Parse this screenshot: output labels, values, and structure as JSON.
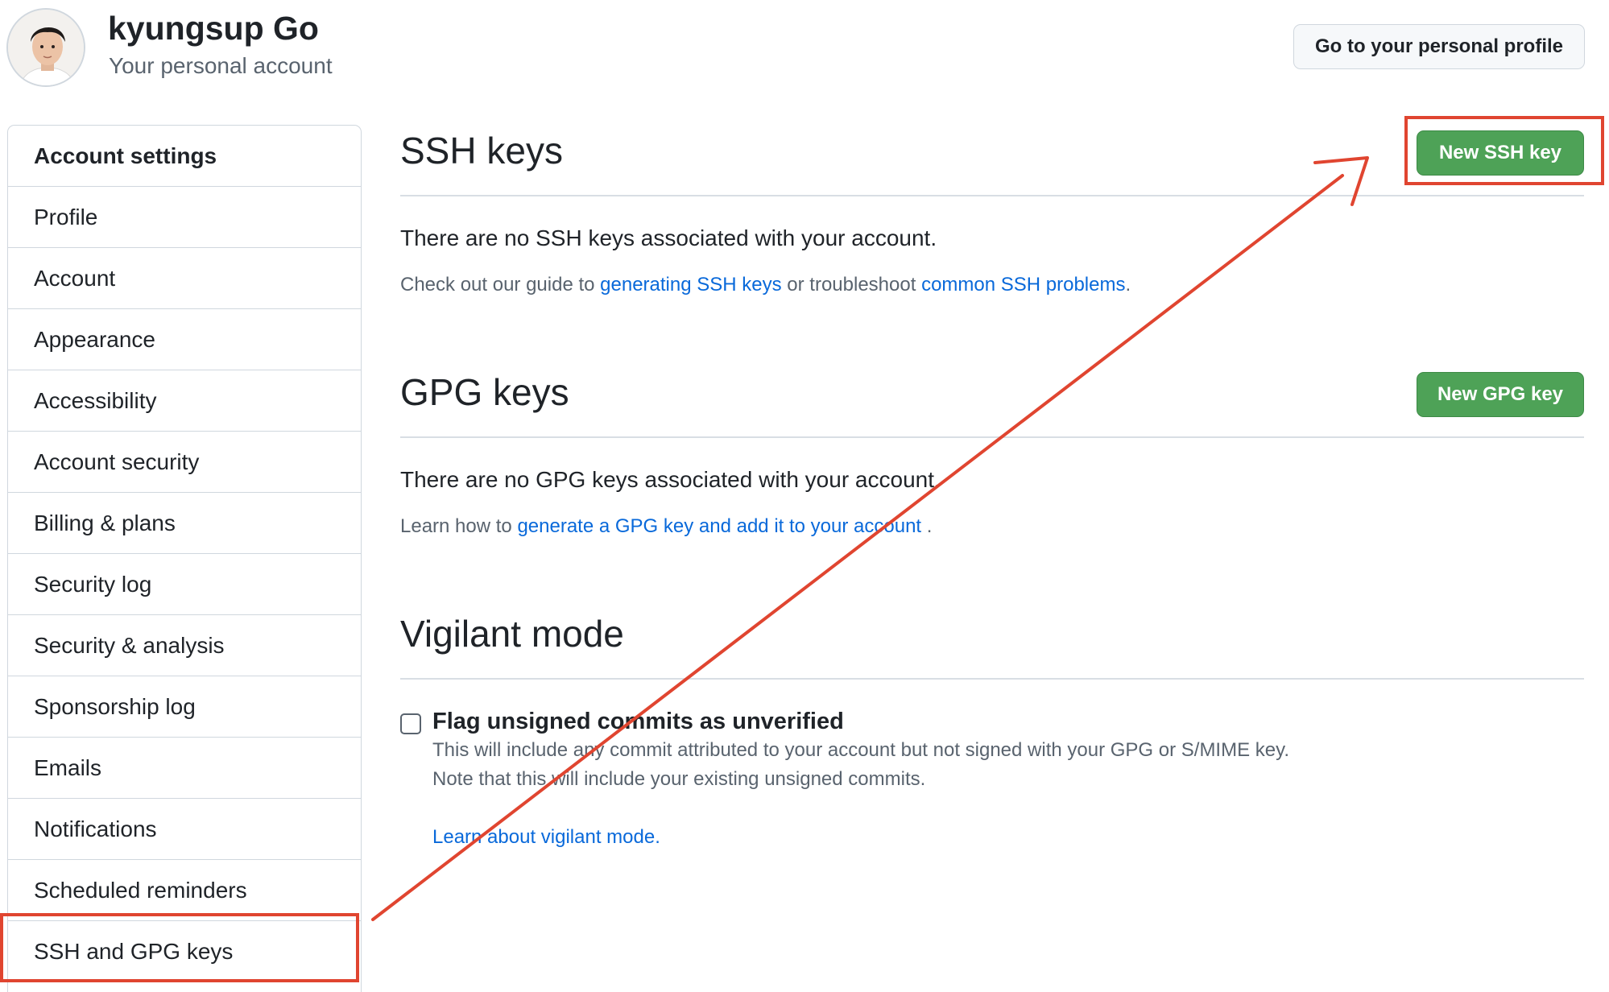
{
  "header": {
    "user_name": "kyungsup Go",
    "subtitle": "Your personal account",
    "profile_button": "Go to your personal profile"
  },
  "sidebar": {
    "heading": "Account settings",
    "items": [
      {
        "label": "Profile"
      },
      {
        "label": "Account"
      },
      {
        "label": "Appearance"
      },
      {
        "label": "Accessibility"
      },
      {
        "label": "Account security"
      },
      {
        "label": "Billing & plans"
      },
      {
        "label": "Security log"
      },
      {
        "label": "Security & analysis"
      },
      {
        "label": "Sponsorship log"
      },
      {
        "label": "Emails"
      },
      {
        "label": "Notifications"
      },
      {
        "label": "Scheduled reminders"
      },
      {
        "label": "SSH and GPG keys"
      }
    ]
  },
  "ssh": {
    "title": "SSH keys",
    "button": "New SSH key",
    "empty": "There are no SSH keys associated with your account.",
    "hint_prefix": "Check out our guide to ",
    "link1": "generating SSH keys",
    "hint_mid": " or troubleshoot ",
    "link2": "common SSH problems",
    "hint_suffix": "."
  },
  "gpg": {
    "title": "GPG keys",
    "button": "New GPG key",
    "empty": "There are no GPG keys associated with your account.",
    "hint_prefix": "Learn how to ",
    "link": "generate a GPG key and add it to your account",
    "hint_suffix": " ."
  },
  "vigilant": {
    "title": "Vigilant mode",
    "checkbox_label": "Flag unsigned commits as unverified",
    "desc_line1": "This will include any commit attributed to your account but not signed with your GPG or S/MIME key.",
    "desc_line2": "Note that this will include your existing unsigned commits.",
    "learn_link": "Learn about vigilant mode."
  },
  "colors": {
    "annotation": "#e04530",
    "primary_button": "#4ea257",
    "link": "#0969da"
  }
}
